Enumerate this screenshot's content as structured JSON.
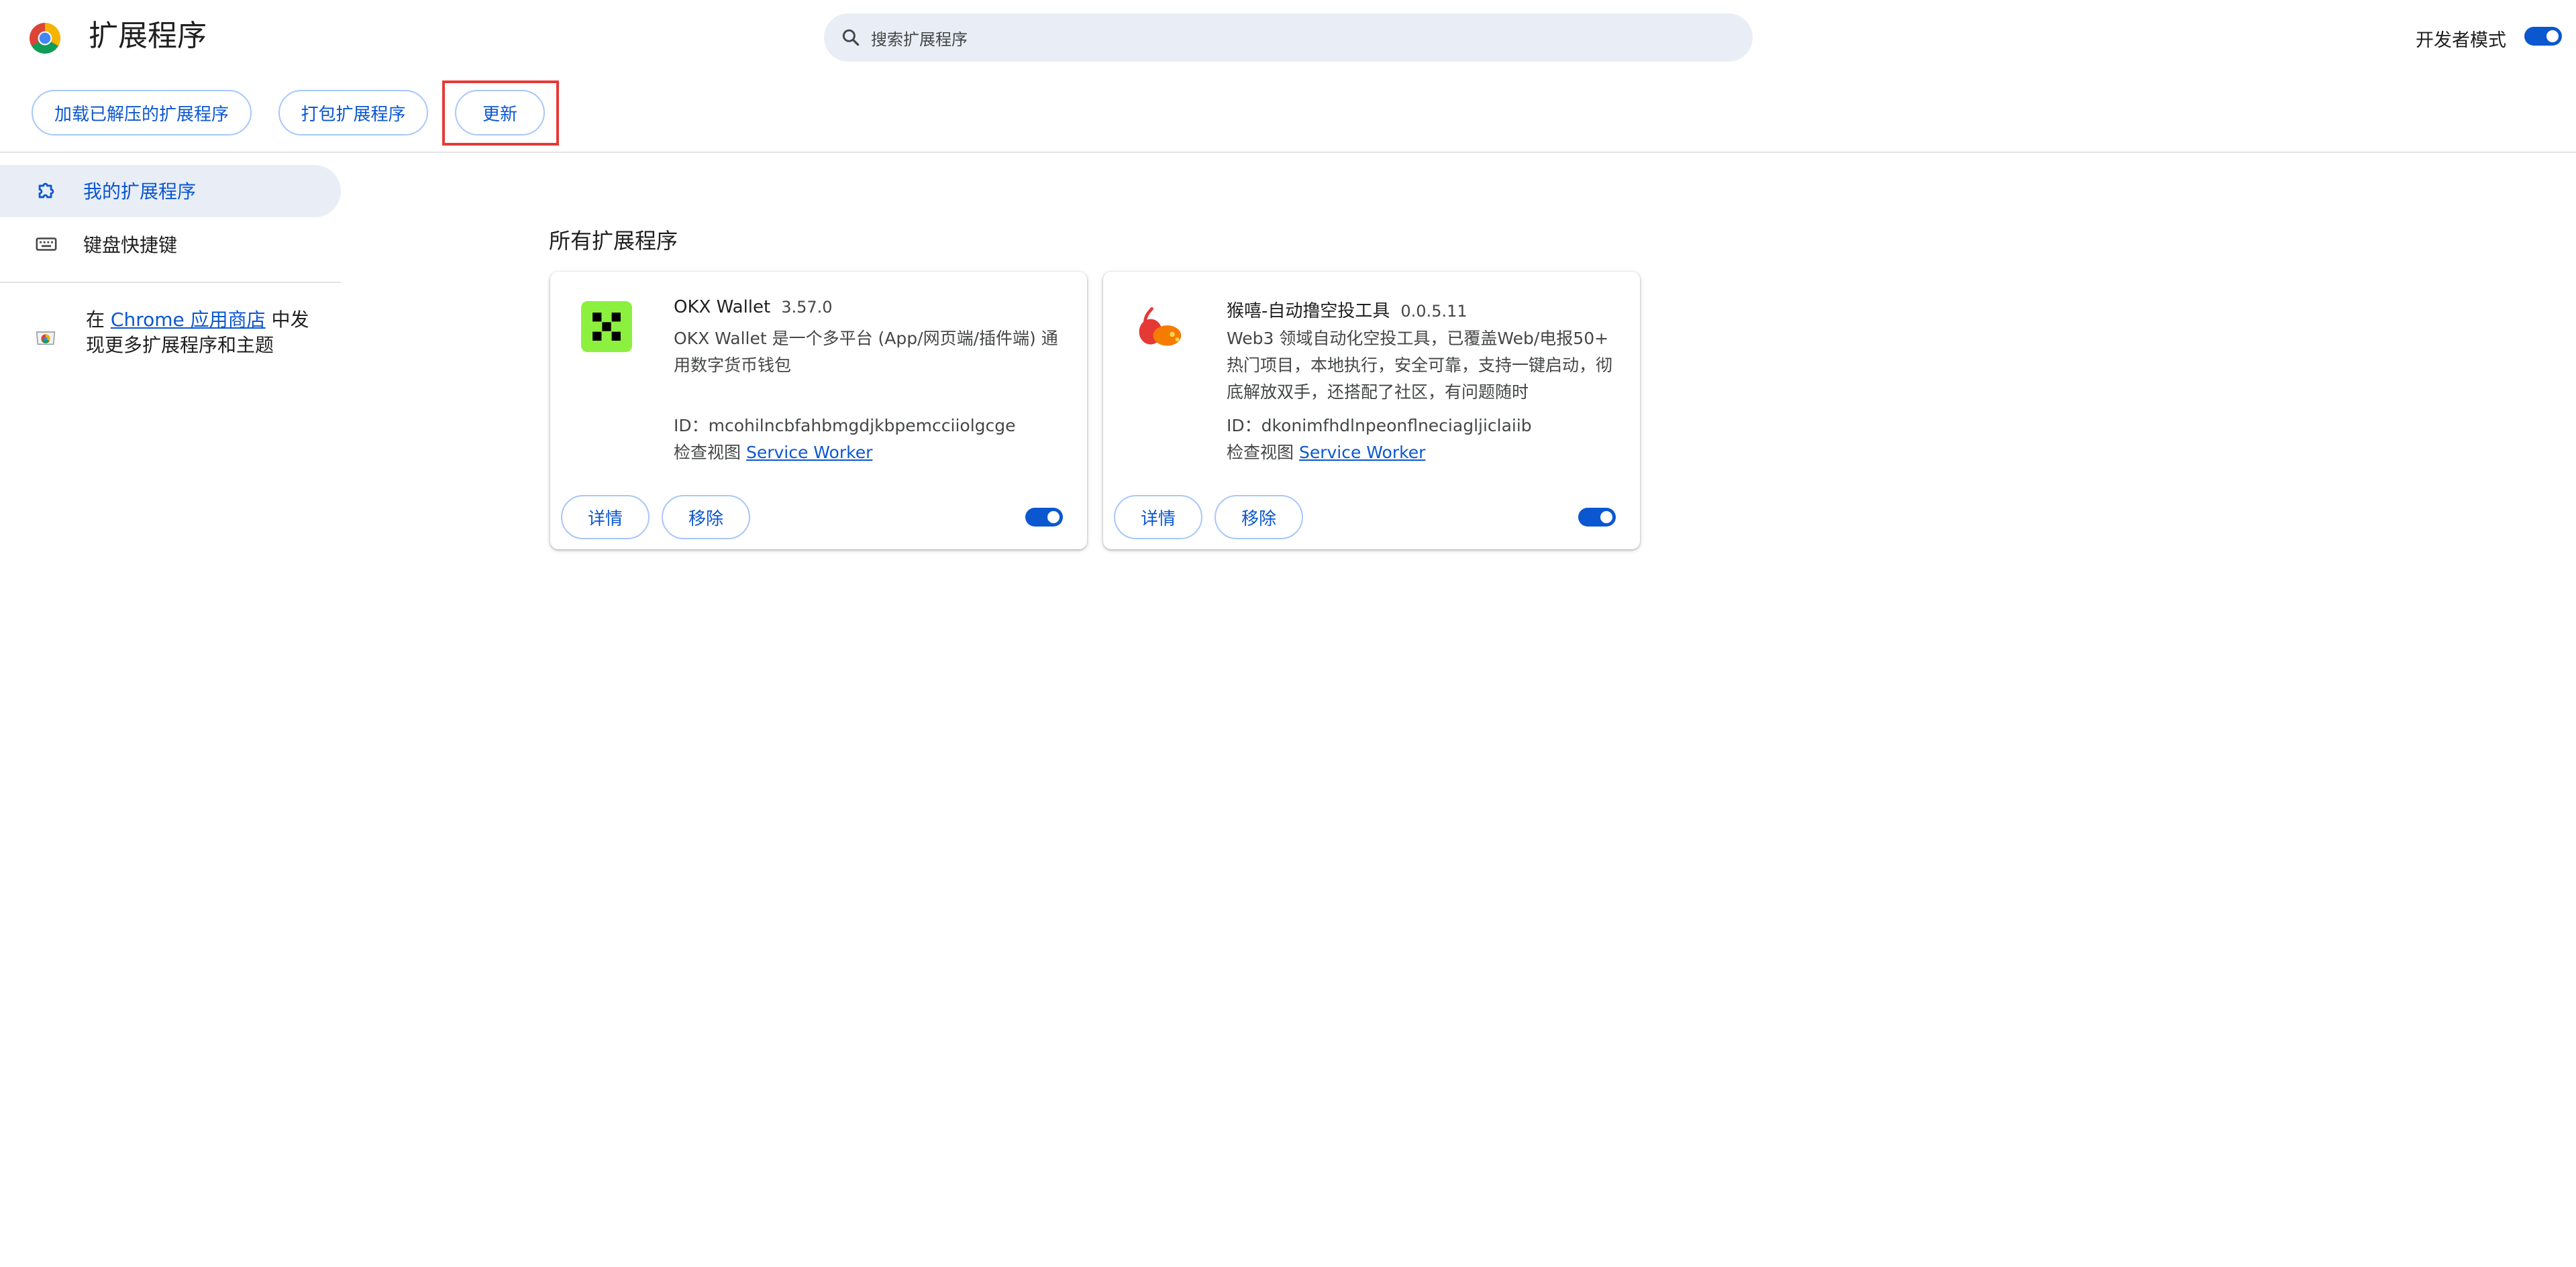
{
  "header": {
    "title": "扩展程序",
    "search_placeholder": "搜索扩展程序",
    "developer_mode_label": "开发者模式",
    "developer_mode_on": true
  },
  "toolbar": {
    "load_unpacked": "加载已解压的扩展程序",
    "pack": "打包扩展程序",
    "update": "更新"
  },
  "sidebar": {
    "items": [
      {
        "label": "我的扩展程序",
        "icon": "extension-icon",
        "active": true
      },
      {
        "label": "键盘快捷键",
        "icon": "keyboard-icon",
        "active": false
      }
    ],
    "store_prefix": "在 ",
    "store_link": "Chrome 应用商店",
    "store_suffix": " 中发现更多扩展程序和主题"
  },
  "main": {
    "section_title": "所有扩展程序",
    "extensions": [
      {
        "name": "OKX Wallet",
        "version": "3.57.0",
        "description": "OKX Wallet 是一个多平台 (App/网页端/插件端) 通用数字货币钱包",
        "id_line": "ID：mcohilncbfahbmgdjkbpemcciiolgcge",
        "inspect_label": "检查视图 ",
        "inspect_link": "Service Worker",
        "details_label": "详情",
        "remove_label": "移除",
        "enabled": true,
        "icon": "okx-logo-icon"
      },
      {
        "name": "猴嘻-自动撸空投工具",
        "version": "0.0.5.11",
        "description": "Web3 领域自动化空投工具，已覆盖Web/电报50+ 热门项目，本地执行，安全可靠，支持一键启动，彻底解放双手，还搭配了社区，有问题随时",
        "id_line": "ID：dkonimfhdlnpeonflneciagljiclaiib",
        "inspect_label": "检查视图 ",
        "inspect_link": "Service Worker",
        "details_label": "详情",
        "remove_label": "移除",
        "enabled": true,
        "icon": "monkey-logo-icon"
      }
    ]
  },
  "colors": {
    "accent": "#0b57d0",
    "highlight_border": "#e53935",
    "sidebar_active_bg": "#e9eef6"
  }
}
